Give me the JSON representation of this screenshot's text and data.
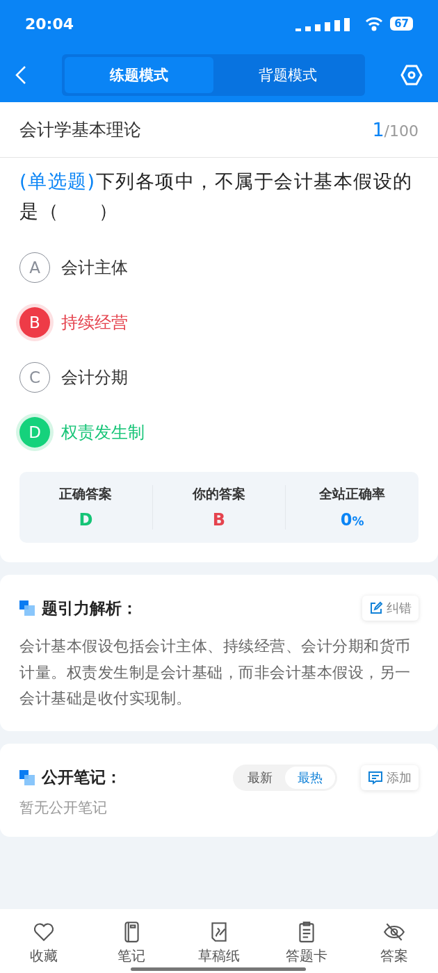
{
  "status_bar": {
    "time": "20:04",
    "battery": "67"
  },
  "header": {
    "tabs": [
      {
        "label": "练题模式",
        "selected": true
      },
      {
        "label": "背题模式",
        "selected": false
      }
    ]
  },
  "question": {
    "category": "会计学基本理论",
    "current": "1",
    "total": "/100",
    "type": "(单选题)",
    "text": "下列各项中，不属于会计基本假设的是（　　）",
    "options": [
      {
        "letter": "A",
        "text": "会计主体",
        "kind": "neutral"
      },
      {
        "letter": "B",
        "text": "持续经营",
        "kind": "wrong"
      },
      {
        "letter": "C",
        "text": "会计分期",
        "kind": "neutral"
      },
      {
        "letter": "D",
        "text": "权责发生制",
        "kind": "correct"
      }
    ],
    "stats": [
      {
        "label": "正确答案",
        "value": "D",
        "kind": "correct"
      },
      {
        "label": "你的答案",
        "value": "B",
        "kind": "wrong"
      },
      {
        "label": "全站正确率",
        "value": "0",
        "unit": "%",
        "kind": "rate"
      }
    ]
  },
  "analysis": {
    "title": "题引力解析：",
    "action": "纠错",
    "text": "会计基本假设包括会计主体、持续经营、会计分期和货币计量。权责发生制是会计基础，而非会计基本假设，另一会计基础是收付实现制。"
  },
  "notes": {
    "title": "公开笔记：",
    "sort": [
      {
        "label": "最新",
        "selected": false
      },
      {
        "label": "最热",
        "selected": true
      }
    ],
    "action": "添加",
    "empty": "暂无公开笔记"
  },
  "bottom_bar": [
    {
      "label": "收藏",
      "kind": "heart"
    },
    {
      "label": "笔记",
      "kind": "notebook"
    },
    {
      "label": "草稿纸",
      "kind": "draft"
    },
    {
      "label": "答题卡",
      "kind": "card"
    },
    {
      "label": "答案",
      "kind": "eye"
    }
  ]
}
